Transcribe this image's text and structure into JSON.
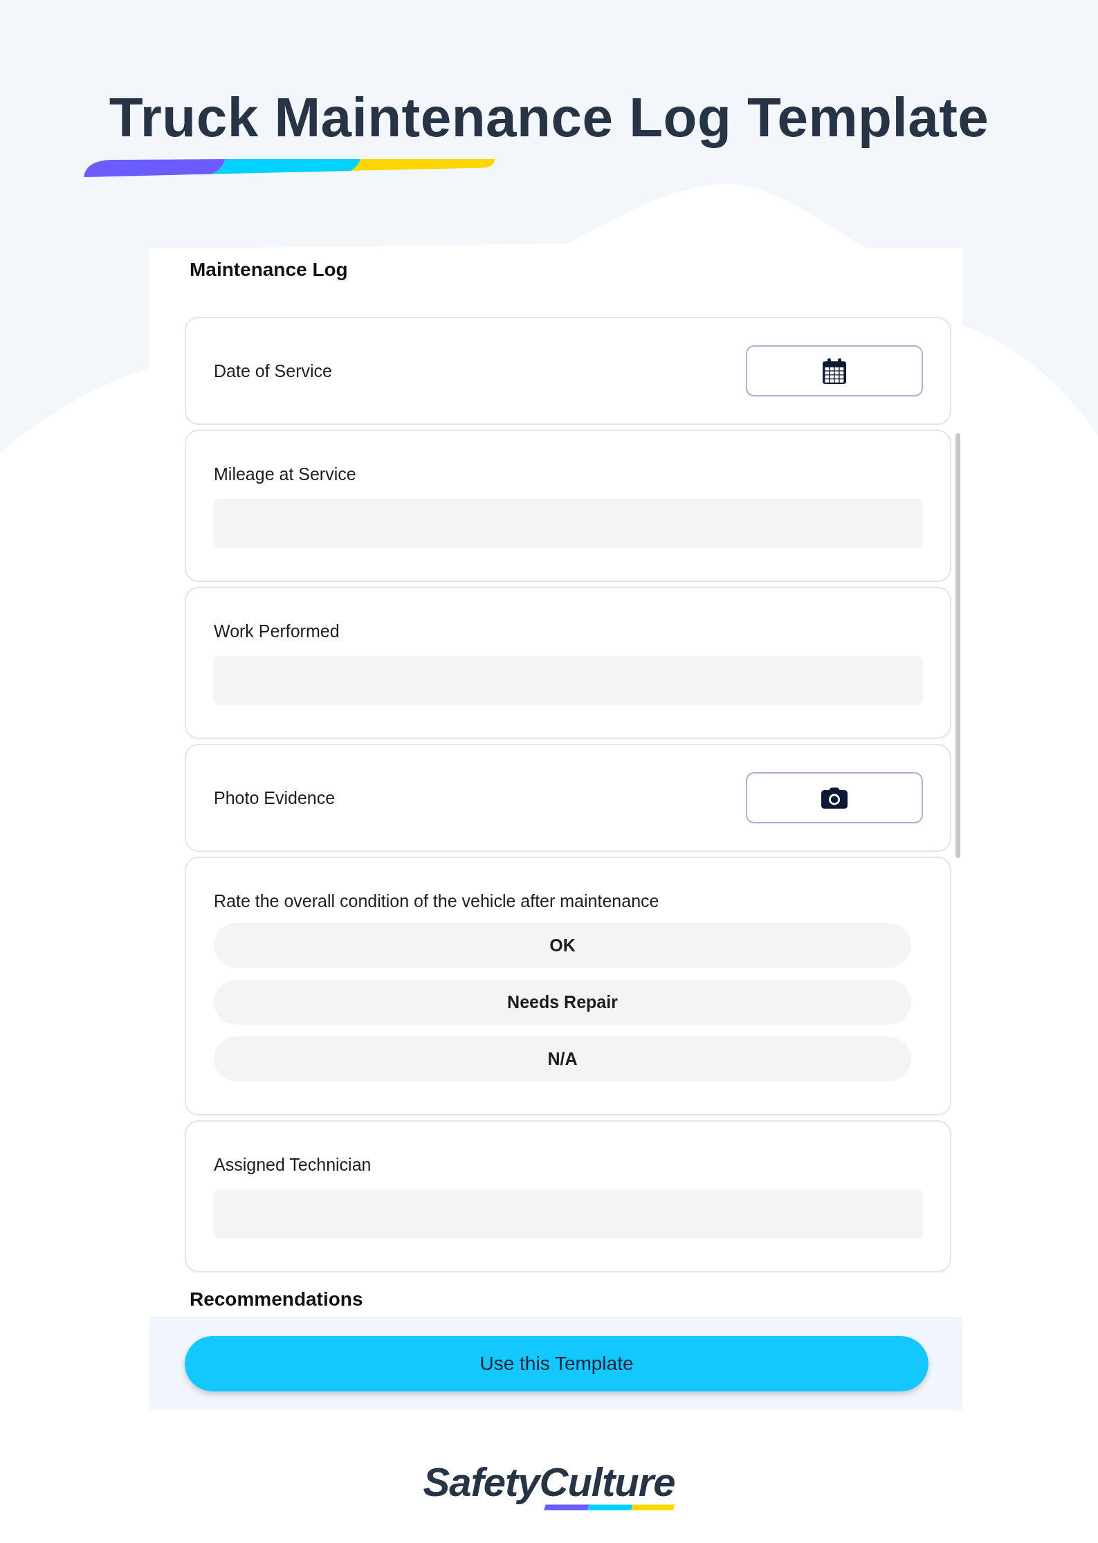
{
  "page": {
    "title": "Truck Maintenance Log Template"
  },
  "form": {
    "section_title": "Maintenance Log",
    "questions": [
      {
        "kind": "date",
        "label": "Date of Service"
      },
      {
        "kind": "text",
        "label": "Mileage at Service"
      },
      {
        "kind": "text",
        "label": "Work Performed"
      },
      {
        "kind": "photo",
        "label": "Photo Evidence"
      },
      {
        "kind": "choice",
        "label": "Rate the overall condition of the vehicle after maintenance",
        "options": [
          {
            "label": "OK",
            "selected": false
          },
          {
            "label": "Needs Repair",
            "selected": false
          },
          {
            "label": "N/A",
            "selected": false
          }
        ]
      },
      {
        "kind": "text",
        "label": "Assigned Technician"
      }
    ],
    "next_section_title": "Recommendations"
  },
  "footer": {
    "button": "Use this Template"
  },
  "logo": {
    "text": "SafetyCulture"
  }
}
